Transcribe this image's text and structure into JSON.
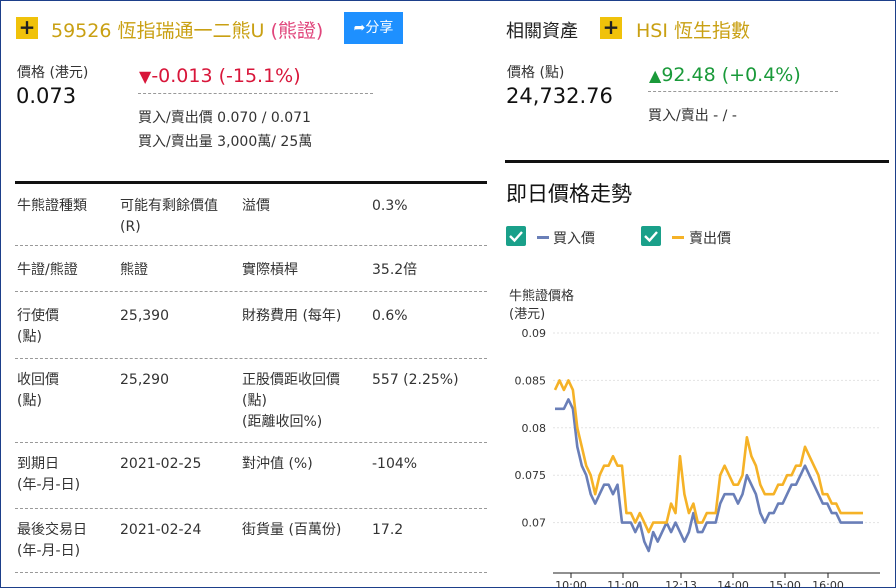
{
  "header": {
    "code_name": "59526 恆指瑞通一二熊U",
    "type_tag": "(熊證)",
    "share_label": "分享"
  },
  "price": {
    "label": "價格 (港元)",
    "value": "0.073",
    "change": "-0.013 (-15.1%)",
    "bid_ask_price": "買入/賣出價 0.070 / 0.071",
    "bid_ask_volume": "買入/賣出量 3,000萬/ 25萬"
  },
  "related": {
    "label": "相關資產",
    "name": "HSI 恆生指數",
    "price_label": "價格 (點)",
    "price_value": "24,732.76",
    "change": "92.48 (+0.4%)",
    "bid_ask": "買入/賣出 - / -"
  },
  "details": [
    {
      "k1": "牛熊證種類",
      "v1": "可能有剩餘價值\n(R)",
      "k2": "溢價",
      "v2": "0.3%"
    },
    {
      "k1": "牛證/熊證",
      "v1": "熊證",
      "k2": "實際槓桿",
      "v2": "35.2倍"
    },
    {
      "k1": "行使價\n(點)",
      "v1": "25,390",
      "k2": "財務費用 (每年)",
      "v2": "0.6%"
    },
    {
      "k1": "收回價\n(點)",
      "v1": "25,290",
      "k2": "正股價距收回價\n(點)\n(距離收回%)",
      "v2": "557 (2.25%)"
    },
    {
      "k1": "到期日\n(年-月-日)",
      "v1": "2021-02-25",
      "k2": "對沖值 (%)",
      "v2": "-104%"
    },
    {
      "k1": "最後交易日\n(年-月-日)",
      "v1": "2021-02-24",
      "k2": "街貨量 (百萬份)",
      "v2": "17.2"
    }
  ],
  "intraday": {
    "title": "即日價格走勢",
    "legend_bid": "買入價",
    "legend_ask": "賣出價",
    "ylabel_line1": "牛熊證價格",
    "ylabel_line2": "(港元)"
  },
  "colors": {
    "gold": "#c9a013",
    "bid_series": "#6a7fb8",
    "ask_series": "#f5b227",
    "red": "#d8163a",
    "green": "#1a9a3a"
  },
  "chart_data": {
    "type": "line",
    "ylabel": "牛熊證價格 (港元)",
    "ylim": [
      0.065,
      0.09
    ],
    "yticks": [
      "0.09",
      "0.085",
      "0.08",
      "0.075",
      "0.07"
    ],
    "xticks": [
      "10:00",
      "11:00",
      "12:13",
      "14:00",
      "15:00",
      "16:00"
    ],
    "series": [
      {
        "name": "買入價",
        "values": [
          0.082,
          0.082,
          0.082,
          0.083,
          0.082,
          0.078,
          0.076,
          0.075,
          0.073,
          0.072,
          0.073,
          0.074,
          0.074,
          0.073,
          0.074,
          0.07,
          0.07,
          0.07,
          0.069,
          0.07,
          0.068,
          0.067,
          0.069,
          0.068,
          0.069,
          0.07,
          0.069,
          0.07,
          0.069,
          0.068,
          0.069,
          0.071,
          0.069,
          0.069,
          0.07,
          0.07,
          0.07,
          0.072,
          0.073,
          0.073,
          0.073,
          0.072,
          0.073,
          0.075,
          0.074,
          0.073,
          0.071,
          0.07,
          0.071,
          0.071,
          0.072,
          0.072,
          0.073,
          0.074,
          0.074,
          0.075,
          0.076,
          0.075,
          0.074,
          0.073,
          0.072,
          0.072,
          0.071,
          0.071,
          0.07,
          0.07,
          0.07,
          0.07,
          0.07,
          0.07
        ]
      },
      {
        "name": "賣出價",
        "values": [
          0.084,
          0.085,
          0.084,
          0.085,
          0.084,
          0.08,
          0.078,
          0.076,
          0.075,
          0.073,
          0.075,
          0.076,
          0.076,
          0.077,
          0.076,
          0.076,
          0.071,
          0.071,
          0.07,
          0.071,
          0.07,
          0.069,
          0.07,
          0.07,
          0.07,
          0.07,
          0.072,
          0.071,
          0.077,
          0.073,
          0.071,
          0.072,
          0.07,
          0.07,
          0.071,
          0.071,
          0.071,
          0.075,
          0.076,
          0.075,
          0.074,
          0.074,
          0.075,
          0.079,
          0.077,
          0.076,
          0.074,
          0.073,
          0.073,
          0.073,
          0.074,
          0.074,
          0.075,
          0.075,
          0.076,
          0.076,
          0.078,
          0.077,
          0.076,
          0.075,
          0.073,
          0.073,
          0.072,
          0.072,
          0.071,
          0.071,
          0.071,
          0.071,
          0.071,
          0.071
        ]
      }
    ]
  }
}
